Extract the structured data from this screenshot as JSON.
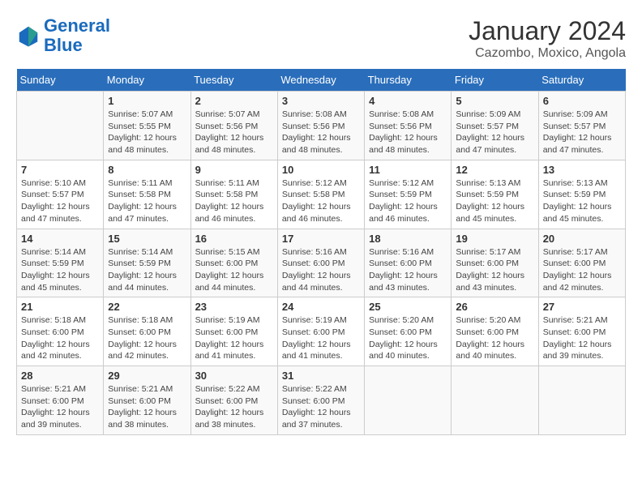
{
  "logo": {
    "line1": "General",
    "line2": "Blue"
  },
  "title": "January 2024",
  "subtitle": "Cazombo, Moxico, Angola",
  "days_of_week": [
    "Sunday",
    "Monday",
    "Tuesday",
    "Wednesday",
    "Thursday",
    "Friday",
    "Saturday"
  ],
  "weeks": [
    [
      {
        "day": "",
        "sunrise": "",
        "sunset": "",
        "daylight": ""
      },
      {
        "day": "1",
        "sunrise": "Sunrise: 5:07 AM",
        "sunset": "Sunset: 5:55 PM",
        "daylight": "Daylight: 12 hours and 48 minutes."
      },
      {
        "day": "2",
        "sunrise": "Sunrise: 5:07 AM",
        "sunset": "Sunset: 5:56 PM",
        "daylight": "Daylight: 12 hours and 48 minutes."
      },
      {
        "day": "3",
        "sunrise": "Sunrise: 5:08 AM",
        "sunset": "Sunset: 5:56 PM",
        "daylight": "Daylight: 12 hours and 48 minutes."
      },
      {
        "day": "4",
        "sunrise": "Sunrise: 5:08 AM",
        "sunset": "Sunset: 5:56 PM",
        "daylight": "Daylight: 12 hours and 48 minutes."
      },
      {
        "day": "5",
        "sunrise": "Sunrise: 5:09 AM",
        "sunset": "Sunset: 5:57 PM",
        "daylight": "Daylight: 12 hours and 47 minutes."
      },
      {
        "day": "6",
        "sunrise": "Sunrise: 5:09 AM",
        "sunset": "Sunset: 5:57 PM",
        "daylight": "Daylight: 12 hours and 47 minutes."
      }
    ],
    [
      {
        "day": "7",
        "sunrise": "Sunrise: 5:10 AM",
        "sunset": "Sunset: 5:57 PM",
        "daylight": "Daylight: 12 hours and 47 minutes."
      },
      {
        "day": "8",
        "sunrise": "Sunrise: 5:11 AM",
        "sunset": "Sunset: 5:58 PM",
        "daylight": "Daylight: 12 hours and 47 minutes."
      },
      {
        "day": "9",
        "sunrise": "Sunrise: 5:11 AM",
        "sunset": "Sunset: 5:58 PM",
        "daylight": "Daylight: 12 hours and 46 minutes."
      },
      {
        "day": "10",
        "sunrise": "Sunrise: 5:12 AM",
        "sunset": "Sunset: 5:58 PM",
        "daylight": "Daylight: 12 hours and 46 minutes."
      },
      {
        "day": "11",
        "sunrise": "Sunrise: 5:12 AM",
        "sunset": "Sunset: 5:59 PM",
        "daylight": "Daylight: 12 hours and 46 minutes."
      },
      {
        "day": "12",
        "sunrise": "Sunrise: 5:13 AM",
        "sunset": "Sunset: 5:59 PM",
        "daylight": "Daylight: 12 hours and 45 minutes."
      },
      {
        "day": "13",
        "sunrise": "Sunrise: 5:13 AM",
        "sunset": "Sunset: 5:59 PM",
        "daylight": "Daylight: 12 hours and 45 minutes."
      }
    ],
    [
      {
        "day": "14",
        "sunrise": "Sunrise: 5:14 AM",
        "sunset": "Sunset: 5:59 PM",
        "daylight": "Daylight: 12 hours and 45 minutes."
      },
      {
        "day": "15",
        "sunrise": "Sunrise: 5:14 AM",
        "sunset": "Sunset: 5:59 PM",
        "daylight": "Daylight: 12 hours and 44 minutes."
      },
      {
        "day": "16",
        "sunrise": "Sunrise: 5:15 AM",
        "sunset": "Sunset: 6:00 PM",
        "daylight": "Daylight: 12 hours and 44 minutes."
      },
      {
        "day": "17",
        "sunrise": "Sunrise: 5:16 AM",
        "sunset": "Sunset: 6:00 PM",
        "daylight": "Daylight: 12 hours and 44 minutes."
      },
      {
        "day": "18",
        "sunrise": "Sunrise: 5:16 AM",
        "sunset": "Sunset: 6:00 PM",
        "daylight": "Daylight: 12 hours and 43 minutes."
      },
      {
        "day": "19",
        "sunrise": "Sunrise: 5:17 AM",
        "sunset": "Sunset: 6:00 PM",
        "daylight": "Daylight: 12 hours and 43 minutes."
      },
      {
        "day": "20",
        "sunrise": "Sunrise: 5:17 AM",
        "sunset": "Sunset: 6:00 PM",
        "daylight": "Daylight: 12 hours and 42 minutes."
      }
    ],
    [
      {
        "day": "21",
        "sunrise": "Sunrise: 5:18 AM",
        "sunset": "Sunset: 6:00 PM",
        "daylight": "Daylight: 12 hours and 42 minutes."
      },
      {
        "day": "22",
        "sunrise": "Sunrise: 5:18 AM",
        "sunset": "Sunset: 6:00 PM",
        "daylight": "Daylight: 12 hours and 42 minutes."
      },
      {
        "day": "23",
        "sunrise": "Sunrise: 5:19 AM",
        "sunset": "Sunset: 6:00 PM",
        "daylight": "Daylight: 12 hours and 41 minutes."
      },
      {
        "day": "24",
        "sunrise": "Sunrise: 5:19 AM",
        "sunset": "Sunset: 6:00 PM",
        "daylight": "Daylight: 12 hours and 41 minutes."
      },
      {
        "day": "25",
        "sunrise": "Sunrise: 5:20 AM",
        "sunset": "Sunset: 6:00 PM",
        "daylight": "Daylight: 12 hours and 40 minutes."
      },
      {
        "day": "26",
        "sunrise": "Sunrise: 5:20 AM",
        "sunset": "Sunset: 6:00 PM",
        "daylight": "Daylight: 12 hours and 40 minutes."
      },
      {
        "day": "27",
        "sunrise": "Sunrise: 5:21 AM",
        "sunset": "Sunset: 6:00 PM",
        "daylight": "Daylight: 12 hours and 39 minutes."
      }
    ],
    [
      {
        "day": "28",
        "sunrise": "Sunrise: 5:21 AM",
        "sunset": "Sunset: 6:00 PM",
        "daylight": "Daylight: 12 hours and 39 minutes."
      },
      {
        "day": "29",
        "sunrise": "Sunrise: 5:21 AM",
        "sunset": "Sunset: 6:00 PM",
        "daylight": "Daylight: 12 hours and 38 minutes."
      },
      {
        "day": "30",
        "sunrise": "Sunrise: 5:22 AM",
        "sunset": "Sunset: 6:00 PM",
        "daylight": "Daylight: 12 hours and 38 minutes."
      },
      {
        "day": "31",
        "sunrise": "Sunrise: 5:22 AM",
        "sunset": "Sunset: 6:00 PM",
        "daylight": "Daylight: 12 hours and 37 minutes."
      },
      {
        "day": "",
        "sunrise": "",
        "sunset": "",
        "daylight": ""
      },
      {
        "day": "",
        "sunrise": "",
        "sunset": "",
        "daylight": ""
      },
      {
        "day": "",
        "sunrise": "",
        "sunset": "",
        "daylight": ""
      }
    ]
  ]
}
